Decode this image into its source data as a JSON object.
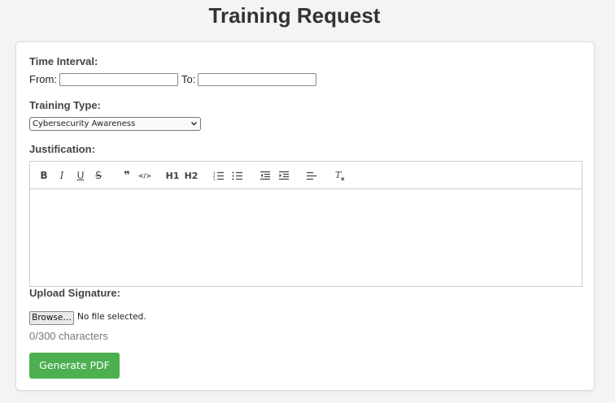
{
  "page": {
    "title": "Training Request"
  },
  "form": {
    "time_interval_label": "Time Interval:",
    "from_label": "From:",
    "to_label": "To:",
    "from_value": "",
    "to_value": "",
    "training_type_label": "Training Type:",
    "training_type_selected": "Cybersecurity Awareness",
    "justification_label": "Justification:",
    "justification_value": "",
    "upload_signature_label": "Upload Signature:",
    "browse_label": "Browse…",
    "file_status": "No file selected.",
    "char_count": "0/300 characters",
    "generate_label": "Generate PDF"
  },
  "toolbar": {
    "bold": "B",
    "italic": "I",
    "underline": "U",
    "strike": "S",
    "quote": "❞",
    "code": "</>",
    "h1": "H1",
    "h2": "H2",
    "icons": [
      "bold-icon",
      "italic-icon",
      "underline-icon",
      "strikethrough-icon",
      "blockquote-icon",
      "code-icon",
      "header-1-icon",
      "header-2-icon",
      "ordered-list-icon",
      "bullet-list-icon",
      "outdent-icon",
      "indent-icon",
      "align-icon",
      "clear-formatting-icon"
    ]
  },
  "colors": {
    "accent": "#4caf50",
    "background": "#f4f4f4",
    "card": "#ffffff"
  }
}
